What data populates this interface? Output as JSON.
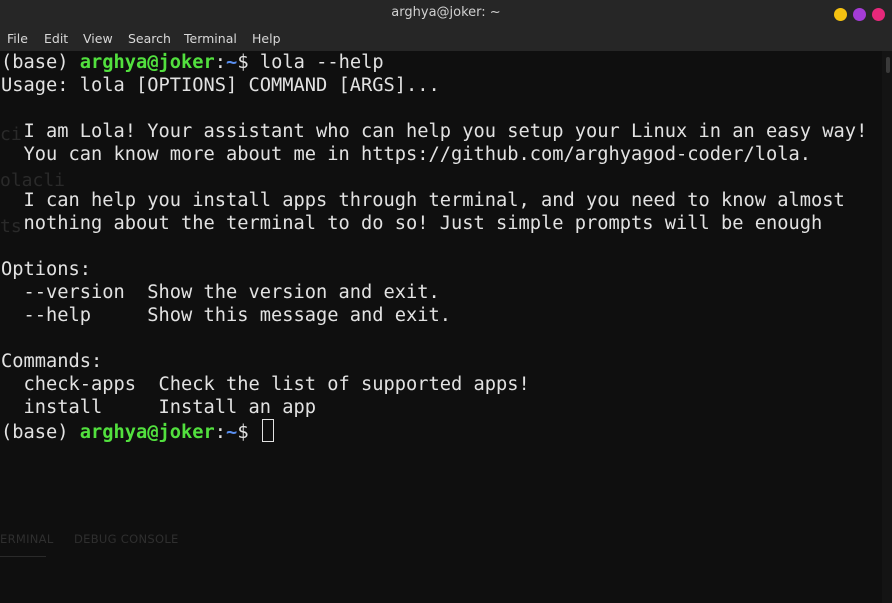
{
  "window": {
    "title": "arghya@joker: ~",
    "buttons": [
      {
        "name": "minimize",
        "color": "#f5c211"
      },
      {
        "name": "maximize",
        "color": "#a43cd6"
      },
      {
        "name": "close",
        "color": "#e6287a"
      }
    ]
  },
  "menu": [
    "File",
    "Edit",
    "View",
    "Search",
    "Terminal",
    "Help"
  ],
  "background_ghost": {
    "text_1": "ci",
    "text_2": "olacli",
    "text_3": "ts",
    "tab_terminal": "ERMINAL",
    "tab_debug": "DEBUG CONSOLE"
  },
  "prompt": {
    "env": "(base) ",
    "user_host": "arghya@joker",
    "colon": ":",
    "path": "~",
    "symbol": "$ "
  },
  "command": "lola --help",
  "output": {
    "usage": "Usage: lola [OPTIONS] COMMAND [ARGS]...",
    "intro_1": "  I am Lola! Your assistant who can help you setup your Linux in an easy way!",
    "intro_2": "  You can know more about me in https://github.com/arghyagod-coder/lola.",
    "intro_3": "  I can help you install apps through terminal, and you need to know almost",
    "intro_4": "  nothing about the terminal to do so! Just simple prompts will be enough",
    "options_header": "Options:",
    "opt_version": "  --version  Show the version and exit.",
    "opt_help": "  --help     Show this message and exit.",
    "commands_header": "Commands:",
    "cmd_check_apps": "  check-apps  Check the list of supported apps!",
    "cmd_install": "  install     Install an app"
  },
  "colors": {
    "user_host": "#52e03e",
    "path": "#5a8ff0",
    "text": "#e2e2e2",
    "background": "#0f0f0f"
  }
}
